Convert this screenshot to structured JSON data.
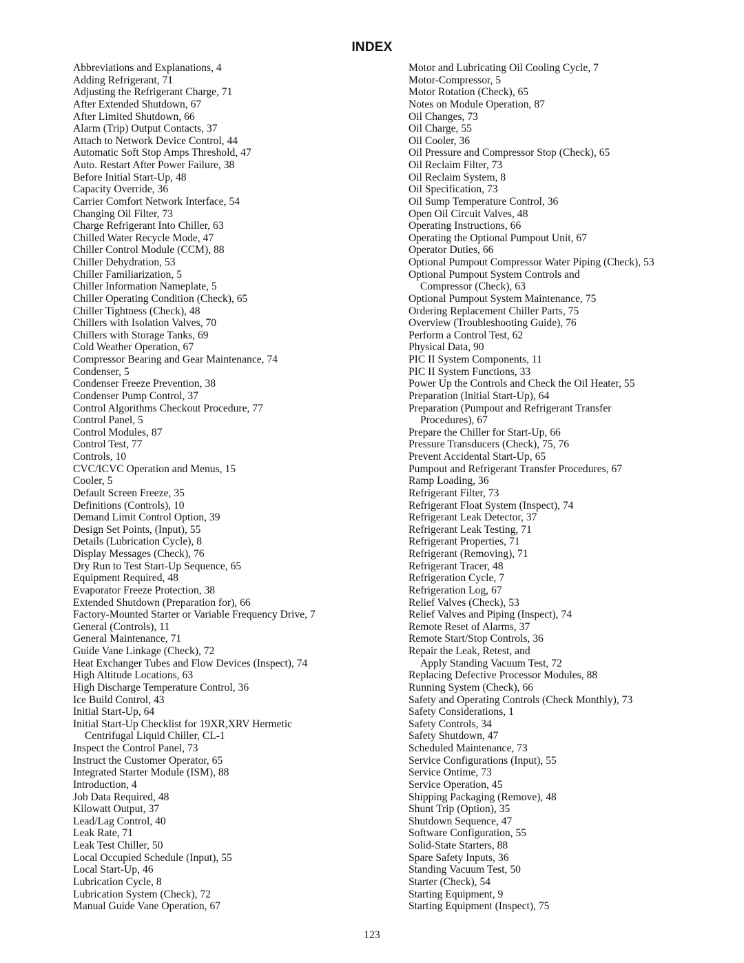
{
  "title": "INDEX",
  "page_number": "123",
  "left_column": [
    {
      "text": "Abbreviations and Explanations, 4"
    },
    {
      "text": "Adding Refrigerant, 71"
    },
    {
      "text": "Adjusting the Refrigerant Charge, 71"
    },
    {
      "text": "After Extended Shutdown, 67"
    },
    {
      "text": "After Limited Shutdown, 66"
    },
    {
      "text": "Alarm (Trip) Output Contacts, 37"
    },
    {
      "text": "Attach to Network Device Control, 44"
    },
    {
      "text": "Automatic Soft Stop Amps Threshold, 47"
    },
    {
      "text": "Auto. Restart After Power Failure, 38"
    },
    {
      "text": "Before Initial Start-Up, 48"
    },
    {
      "text": "Capacity Override, 36"
    },
    {
      "text": "Carrier Comfort Network Interface, 54"
    },
    {
      "text": "Changing Oil Filter, 73"
    },
    {
      "text": "Charge Refrigerant Into Chiller, 63"
    },
    {
      "text": "Chilled Water Recycle Mode, 47"
    },
    {
      "text": "Chiller Control Module (CCM), 88"
    },
    {
      "text": "Chiller Dehydration, 53"
    },
    {
      "text": "Chiller Familiarization, 5"
    },
    {
      "text": "Chiller Information Nameplate, 5"
    },
    {
      "text": "Chiller Operating Condition (Check), 65"
    },
    {
      "text": "Chiller Tightness (Check), 48"
    },
    {
      "text": "Chillers with Isolation Valves, 70"
    },
    {
      "text": "Chillers with Storage Tanks, 69"
    },
    {
      "text": "Cold Weather Operation, 67"
    },
    {
      "text": "Compressor Bearing and Gear Maintenance, 74"
    },
    {
      "text": "Condenser, 5"
    },
    {
      "text": "Condenser Freeze Prevention, 38"
    },
    {
      "text": "Condenser Pump Control, 37"
    },
    {
      "text": "Control Algorithms Checkout Procedure, 77"
    },
    {
      "text": "Control Panel, 5"
    },
    {
      "text": "Control Modules, 87"
    },
    {
      "text": "Control Test, 77"
    },
    {
      "text": "Controls, 10"
    },
    {
      "text": "CVC/ICVC Operation and Menus, 15"
    },
    {
      "text": "Cooler, 5"
    },
    {
      "text": "Default Screen Freeze, 35"
    },
    {
      "text": "Definitions (Controls), 10"
    },
    {
      "text": "Demand Limit Control Option, 39"
    },
    {
      "text": "Design Set Points, (Input), 55"
    },
    {
      "text": "Details (Lubrication Cycle), 8"
    },
    {
      "text": "Display Messages (Check), 76"
    },
    {
      "text": "Dry Run to Test Start-Up Sequence, 65"
    },
    {
      "text": "Equipment Required, 48"
    },
    {
      "text": "Evaporator Freeze Protection, 38"
    },
    {
      "text": "Extended Shutdown (Preparation for), 66"
    },
    {
      "text": "Factory-Mounted Starter or Variable Frequency Drive, 7"
    },
    {
      "text": "General (Controls), 11"
    },
    {
      "text": "General Maintenance, 71"
    },
    {
      "text": "Guide Vane Linkage (Check), 72"
    },
    {
      "text": "Heat Exchanger Tubes and Flow Devices (Inspect), 74"
    },
    {
      "text": "High Altitude Locations, 63"
    },
    {
      "text": "High Discharge Temperature Control, 36"
    },
    {
      "text": "Ice Build Control, 43"
    },
    {
      "text": "Initial Start-Up, 64"
    },
    {
      "text": "Initial Start-Up Checklist for 19XR,XRV Hermetic",
      "cont": "Centrifugal Liquid Chiller, CL-1"
    },
    {
      "text": "Inspect the Control Panel, 73"
    },
    {
      "text": "Instruct the Customer Operator, 65"
    },
    {
      "text": "Integrated Starter Module (ISM), 88"
    },
    {
      "text": "Introduction, 4"
    },
    {
      "text": "Job Data Required, 48"
    },
    {
      "text": "Kilowatt Output, 37"
    },
    {
      "text": "Lead/Lag Control, 40"
    },
    {
      "text": "Leak Rate, 71"
    },
    {
      "text": "Leak Test Chiller, 50"
    },
    {
      "text": "Local Occupied Schedule (Input), 55"
    },
    {
      "text": "Local Start-Up, 46"
    },
    {
      "text": "Lubrication Cycle, 8"
    },
    {
      "text": "Lubrication System (Check), 72"
    },
    {
      "text": "Manual Guide Vane Operation, 67"
    }
  ],
  "right_column": [
    {
      "text": "Motor and Lubricating Oil Cooling Cycle, 7"
    },
    {
      "text": "Motor-Compressor, 5"
    },
    {
      "text": "Motor Rotation (Check), 65"
    },
    {
      "text": "Notes on Module Operation, 87"
    },
    {
      "text": "Oil Changes, 73"
    },
    {
      "text": "Oil Charge, 55"
    },
    {
      "text": "Oil Cooler, 36"
    },
    {
      "text": "Oil Pressure and Compressor Stop (Check), 65"
    },
    {
      "text": "Oil Reclaim Filter, 73"
    },
    {
      "text": "Oil Reclaim System, 8"
    },
    {
      "text": "Oil Specification, 73"
    },
    {
      "text": "Oil Sump Temperature Control, 36"
    },
    {
      "text": "Open Oil Circuit Valves, 48"
    },
    {
      "text": "Operating Instructions, 66"
    },
    {
      "text": "Operating the Optional Pumpout Unit, 67"
    },
    {
      "text": "Operator Duties, 66"
    },
    {
      "text": "Optional Pumpout Compressor Water Piping (Check), 53"
    },
    {
      "text": "Optional Pumpout System Controls and",
      "cont": "Compressor (Check), 63"
    },
    {
      "text": "Optional Pumpout System Maintenance, 75"
    },
    {
      "text": "Ordering Replacement Chiller Parts, 75"
    },
    {
      "text": "Overview (Troubleshooting Guide), 76"
    },
    {
      "text": "Perform a Control Test, 62"
    },
    {
      "text": "Physical Data, 90"
    },
    {
      "text": "PIC II System Components, 11"
    },
    {
      "text": "PIC II System Functions, 33"
    },
    {
      "text": "Power Up the Controls and Check the Oil Heater, 55"
    },
    {
      "text": "Preparation (Initial Start-Up), 64"
    },
    {
      "text": "Preparation (Pumpout and Refrigerant Transfer",
      "cont": "Procedures), 67"
    },
    {
      "text": "Prepare the Chiller for Start-Up, 66"
    },
    {
      "text": "Pressure Transducers (Check), 75, 76"
    },
    {
      "text": "Prevent Accidental Start-Up, 65"
    },
    {
      "text": "Pumpout and Refrigerant Transfer Procedures, 67"
    },
    {
      "text": "Ramp Loading, 36"
    },
    {
      "text": "Refrigerant Filter, 73"
    },
    {
      "text": "Refrigerant Float System (Inspect), 74"
    },
    {
      "text": "Refrigerant Leak Detector, 37"
    },
    {
      "text": "Refrigerant Leak Testing, 71"
    },
    {
      "text": "Refrigerant Properties, 71"
    },
    {
      "text": "Refrigerant (Removing), 71"
    },
    {
      "text": "Refrigerant Tracer, 48"
    },
    {
      "text": "Refrigeration Cycle, 7"
    },
    {
      "text": "Refrigeration Log, 67"
    },
    {
      "text": "Relief Valves (Check), 53"
    },
    {
      "text": "Relief Valves and Piping (Inspect), 74"
    },
    {
      "text": "Remote Reset of Alarms, 37"
    },
    {
      "text": "Remote Start/Stop Controls, 36"
    },
    {
      "text": "Repair the Leak, Retest, and",
      "cont": "Apply Standing Vacuum Test, 72"
    },
    {
      "text": "Replacing Defective Processor Modules, 88"
    },
    {
      "text": "Running System (Check), 66"
    },
    {
      "text": "Safety and Operating Controls (Check Monthly), 73"
    },
    {
      "text": "Safety Considerations, 1"
    },
    {
      "text": "Safety Controls, 34"
    },
    {
      "text": "Safety Shutdown, 47"
    },
    {
      "text": "Scheduled Maintenance, 73"
    },
    {
      "text": "Service Configurations (Input), 55"
    },
    {
      "text": "Service Ontime, 73"
    },
    {
      "text": "Service Operation, 45"
    },
    {
      "text": "Shipping Packaging (Remove), 48"
    },
    {
      "text": "Shunt Trip (Option), 35"
    },
    {
      "text": "Shutdown Sequence, 47"
    },
    {
      "text": "Software Configuration, 55"
    },
    {
      "text": "Solid-State Starters, 88"
    },
    {
      "text": "Spare Safety Inputs, 36"
    },
    {
      "text": "Standing Vacuum Test, 50"
    },
    {
      "text": "Starter (Check), 54"
    },
    {
      "text": "Starting Equipment, 9"
    },
    {
      "text": "Starting Equipment (Inspect), 75"
    }
  ]
}
